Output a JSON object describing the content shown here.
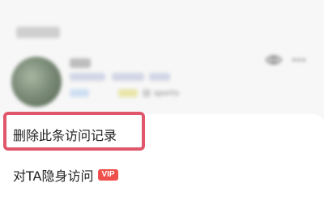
{
  "background": {
    "user_tag": "sports"
  },
  "sheet": {
    "delete_record_label": "删除此条访问记录",
    "hidden_visit_label": "对TA隐身访问",
    "vip_badge": "VIP"
  },
  "colors": {
    "highlight": "#e0566a",
    "vip": "#f0504b"
  },
  "icons": [
    "eye-icon",
    "more-icon"
  ]
}
